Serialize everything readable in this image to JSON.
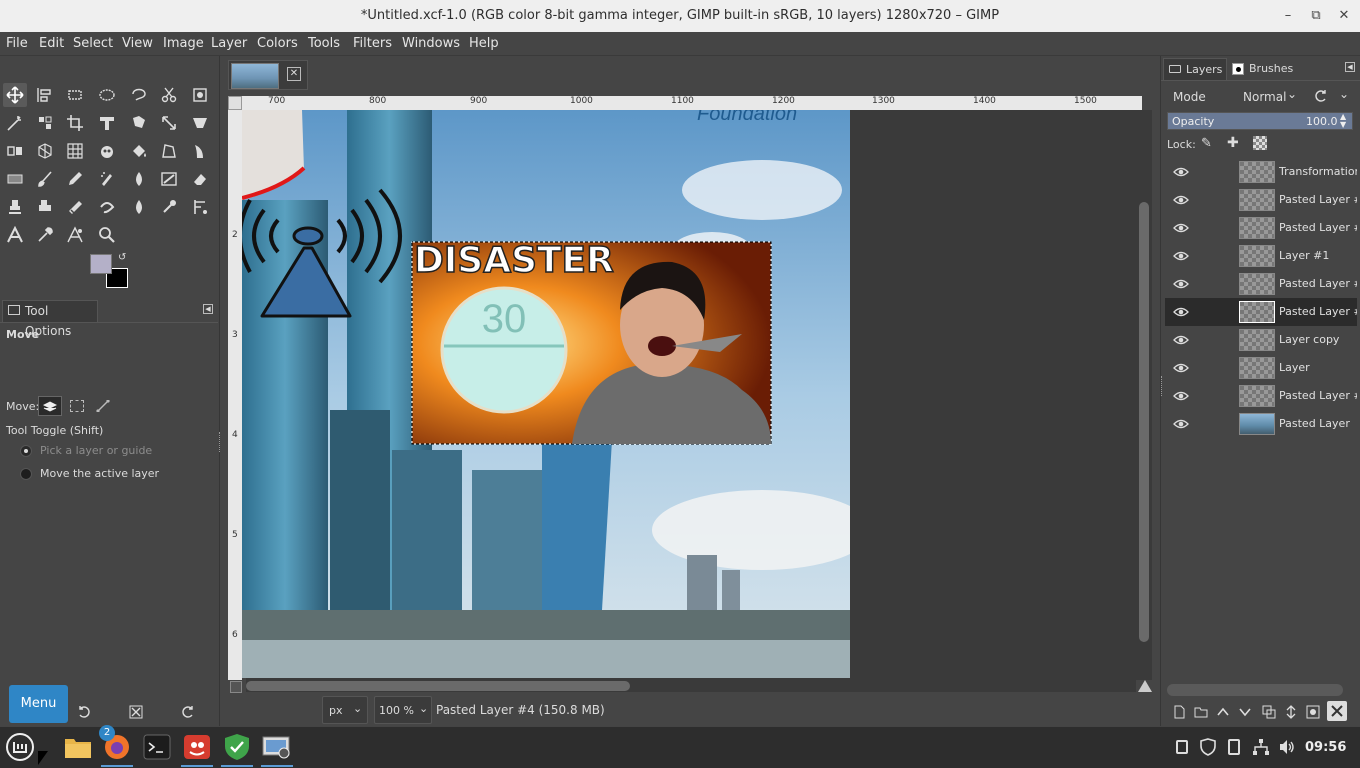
{
  "window": {
    "title": "*Untitled.xcf-1.0 (RGB color 8-bit gamma integer, GIMP built-in sRGB, 10 layers) 1280x720 – GIMP",
    "minimize": "–",
    "maximize": "⧉",
    "close": "✕"
  },
  "menu": [
    "File",
    "Edit",
    "Select",
    "View",
    "Image",
    "Layer",
    "Colors",
    "Tools",
    "Filters",
    "Windows",
    "Help"
  ],
  "tool_options": {
    "tab_label": "Tool Options",
    "tool_name": "Move",
    "move_label": "Move:",
    "toggle_label": "Tool Toggle  (Shift)",
    "option_pick": "Pick a layer or guide",
    "option_move": "Move the active layer"
  },
  "panel_buttons": {
    "menu_label": "Menu"
  },
  "rulers": {
    "h_ticks": [
      "700",
      "800",
      "900",
      "1000",
      "1100",
      "1200",
      "1300",
      "1400",
      "1500"
    ],
    "v_ticks": [
      "2",
      "3",
      "4",
      "5",
      "6"
    ]
  },
  "canvas": {
    "disaster_text": "DISASTER",
    "pill_number": "30",
    "foundation_text": "Foundation"
  },
  "status": {
    "unit": "px",
    "zoom": "100 %",
    "message": "Pasted Layer #4 (150.8 MB)"
  },
  "layers_panel": {
    "tab_layers": "Layers",
    "tab_brushes": "Brushes",
    "mode_label": "Mode",
    "mode_value": "Normal",
    "opacity_label": "Opacity",
    "opacity_value": "100.0",
    "lock_label": "Lock:",
    "layers": [
      {
        "name": "Transformation"
      },
      {
        "name": "Pasted Layer #"
      },
      {
        "name": "Pasted Layer #"
      },
      {
        "name": "Layer #1"
      },
      {
        "name": "Pasted Layer #"
      },
      {
        "name": "Pasted Layer #"
      },
      {
        "name": "Layer copy"
      },
      {
        "name": "Layer"
      },
      {
        "name": "Pasted Layer #"
      },
      {
        "name": "Pasted Layer"
      }
    ],
    "selected_index": 5
  },
  "taskbar": {
    "firefox_badge": "2",
    "clock": "09:56"
  },
  "colors": {
    "accent": "#2f86c6",
    "selected_row": "#2b2b2b",
    "foreground": "#b4b0c8",
    "background": "#000000"
  }
}
